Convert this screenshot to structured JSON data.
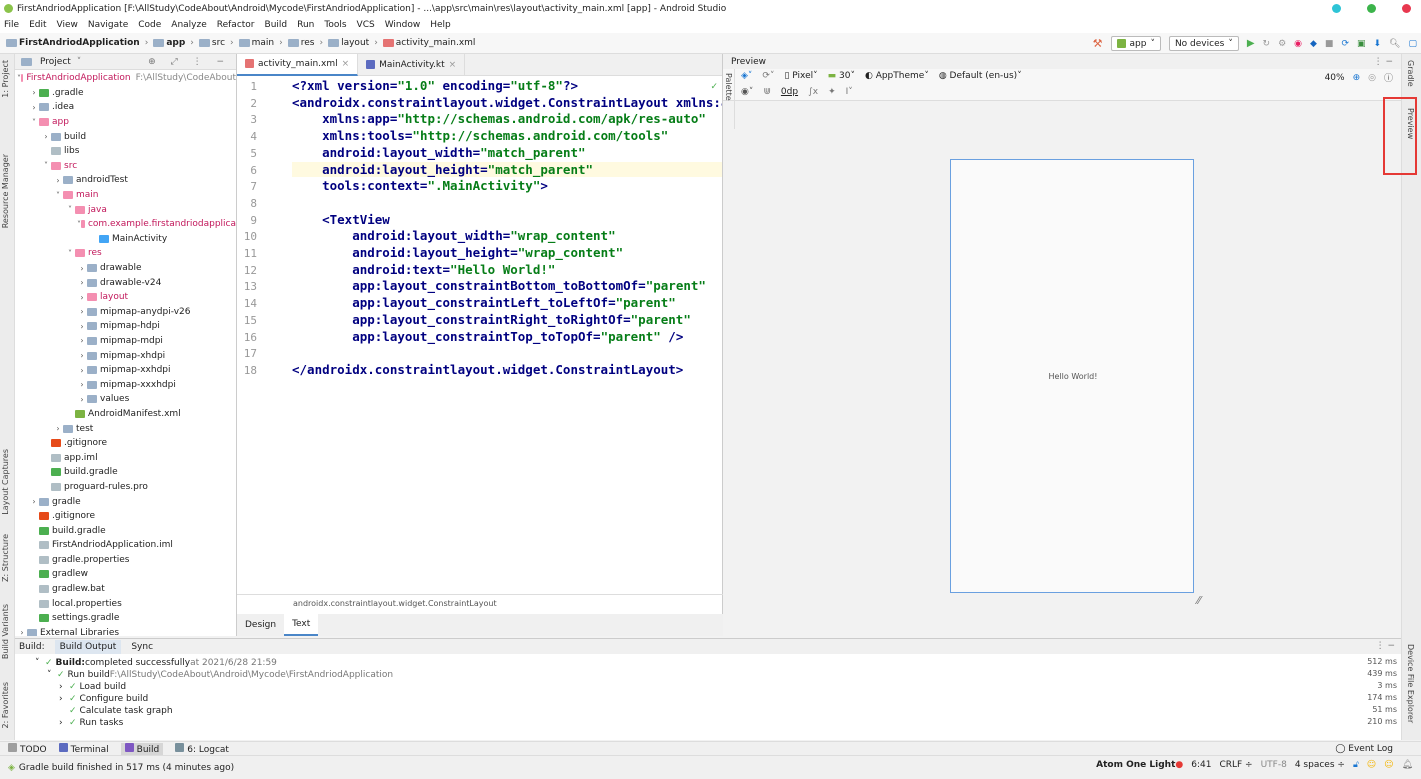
{
  "window": {
    "title": "FirstAndriodApplication [F:\\AllStudy\\CodeAbout\\Android\\Mycode\\FirstAndriodApplication] - ...\\app\\src\\main\\res\\layout\\activity_main.xml [app] - Android Studio"
  },
  "menu": [
    "File",
    "Edit",
    "View",
    "Navigate",
    "Code",
    "Analyze",
    "Refactor",
    "Build",
    "Run",
    "Tools",
    "VCS",
    "Window",
    "Help"
  ],
  "breadcrumb": [
    "FirstAndriodApplication",
    "app",
    "src",
    "main",
    "res",
    "layout",
    "activity_main.xml"
  ],
  "toolbar": {
    "module": "app",
    "devices": "No devices"
  },
  "project_panel": {
    "title": "Project",
    "tree": [
      {
        "label": "FirstAndriodApplication",
        "extra": "F:\\AllStudy\\CodeAbout",
        "indent": 0,
        "arrow": "˅",
        "red": true
      },
      {
        "label": ".gradle",
        "indent": 1,
        "arrow": "›"
      },
      {
        "label": ".idea",
        "indent": 1,
        "arrow": "›"
      },
      {
        "label": "app",
        "indent": 1,
        "arrow": "˅",
        "red": true
      },
      {
        "label": "build",
        "indent": 2,
        "arrow": "›"
      },
      {
        "label": "libs",
        "indent": 2,
        "arrow": ""
      },
      {
        "label": "src",
        "indent": 2,
        "arrow": "˅",
        "red": true
      },
      {
        "label": "androidTest",
        "indent": 3,
        "arrow": "›"
      },
      {
        "label": "main",
        "indent": 3,
        "arrow": "˅",
        "red": true
      },
      {
        "label": "java",
        "indent": 4,
        "arrow": "˅",
        "red": true
      },
      {
        "label": "com.example.firstandriodapplica",
        "indent": 5,
        "arrow": "˅",
        "red": true
      },
      {
        "label": "MainActivity",
        "indent": 6,
        "arrow": ""
      },
      {
        "label": "res",
        "indent": 4,
        "arrow": "˅",
        "red": true
      },
      {
        "label": "drawable",
        "indent": 5,
        "arrow": "›"
      },
      {
        "label": "drawable-v24",
        "indent": 5,
        "arrow": "›"
      },
      {
        "label": "layout",
        "indent": 5,
        "arrow": "›",
        "red": true
      },
      {
        "label": "mipmap-anydpi-v26",
        "indent": 5,
        "arrow": "›"
      },
      {
        "label": "mipmap-hdpi",
        "indent": 5,
        "arrow": "›"
      },
      {
        "label": "mipmap-mdpi",
        "indent": 5,
        "arrow": "›"
      },
      {
        "label": "mipmap-xhdpi",
        "indent": 5,
        "arrow": "›"
      },
      {
        "label": "mipmap-xxhdpi",
        "indent": 5,
        "arrow": "›"
      },
      {
        "label": "mipmap-xxxhdpi",
        "indent": 5,
        "arrow": "›"
      },
      {
        "label": "values",
        "indent": 5,
        "arrow": "›"
      },
      {
        "label": "AndroidManifest.xml",
        "indent": 4,
        "arrow": ""
      },
      {
        "label": "test",
        "indent": 3,
        "arrow": "›"
      },
      {
        "label": ".gitignore",
        "indent": 2,
        "arrow": ""
      },
      {
        "label": "app.iml",
        "indent": 2,
        "arrow": ""
      },
      {
        "label": "build.gradle",
        "indent": 2,
        "arrow": ""
      },
      {
        "label": "proguard-rules.pro",
        "indent": 2,
        "arrow": ""
      },
      {
        "label": "gradle",
        "indent": 1,
        "arrow": "›"
      },
      {
        "label": ".gitignore",
        "indent": 1,
        "arrow": ""
      },
      {
        "label": "build.gradle",
        "indent": 1,
        "arrow": ""
      },
      {
        "label": "FirstAndriodApplication.iml",
        "indent": 1,
        "arrow": ""
      },
      {
        "label": "gradle.properties",
        "indent": 1,
        "arrow": ""
      },
      {
        "label": "gradlew",
        "indent": 1,
        "arrow": ""
      },
      {
        "label": "gradlew.bat",
        "indent": 1,
        "arrow": ""
      },
      {
        "label": "local.properties",
        "indent": 1,
        "arrow": ""
      },
      {
        "label": "settings.gradle",
        "indent": 1,
        "arrow": ""
      },
      {
        "label": "External Libraries",
        "indent": 0,
        "arrow": "›"
      }
    ]
  },
  "editor": {
    "tabs": [
      {
        "label": "activity_main.xml",
        "active": true
      },
      {
        "label": "MainActivity.kt",
        "active": false
      }
    ],
    "lines": [
      "<?xml version=\"1.0\" encoding=\"utf-8\"?>",
      "<androidx.constraintlayout.widget.ConstraintLayout xmlns:and",
      "    xmlns:app=\"http://schemas.android.com/apk/res-auto\"",
      "    xmlns:tools=\"http://schemas.android.com/tools\"",
      "    android:layout_width=\"match_parent\"",
      "    android:layout_height=\"match_parent\"",
      "    tools:context=\".MainActivity\">",
      "",
      "    <TextView",
      "        android:layout_width=\"wrap_content\"",
      "        android:layout_height=\"wrap_content\"",
      "        android:text=\"Hello World!\"",
      "        app:layout_constraintBottom_toBottomOf=\"parent\"",
      "        app:layout_constraintLeft_toLeftOf=\"parent\"",
      "        app:layout_constraintRight_toRightOf=\"parent\"",
      "        app:layout_constraintTop_toTopOf=\"parent\" />",
      "",
      "</androidx.constraintlayout.widget.ConstraintLayout>"
    ],
    "highlight_line": 6,
    "breadcrumb": "androidx.constraintlayout.widget.ConstraintLayout",
    "mode_tabs": [
      "Design",
      "Text"
    ],
    "active_mode": "Text"
  },
  "preview": {
    "title": "Preview",
    "device": "Pixel",
    "api": "30",
    "theme": "AppTheme",
    "locale": "Default (en-us)",
    "zoom": "40%",
    "margin": "0dp",
    "phone_text": "Hello World!"
  },
  "build": {
    "tabs": [
      "Build:",
      "Build Output",
      "Sync"
    ],
    "lines": [
      {
        "prefix": "Build:",
        "text": " completed successfully",
        "suffix": " at 2021/6/28 21:59",
        "time": "512 ms",
        "indent": 0,
        "arrow": "˅"
      },
      {
        "prefix": "",
        "text": "Run build",
        "suffix": " F:\\AllStudy\\CodeAbout\\Android\\Mycode\\FirstAndriodApplication",
        "time": "439 ms",
        "indent": 1,
        "arrow": "˅"
      },
      {
        "prefix": "",
        "text": "Load build",
        "suffix": "",
        "time": "3 ms",
        "indent": 2,
        "arrow": "›"
      },
      {
        "prefix": "",
        "text": "Configure build",
        "suffix": "",
        "time": "174 ms",
        "indent": 2,
        "arrow": "›"
      },
      {
        "prefix": "",
        "text": "Calculate task graph",
        "suffix": "",
        "time": "51 ms",
        "indent": 2,
        "arrow": ""
      },
      {
        "prefix": "",
        "text": "Run tasks",
        "suffix": "",
        "time": "210 ms",
        "indent": 2,
        "arrow": "›"
      }
    ]
  },
  "bottom_tabs": [
    "TODO",
    "Terminal",
    "Build",
    "6: Logcat"
  ],
  "event_log": "Event Log",
  "status": {
    "message": "Gradle build finished in 517 ms (4 minutes ago)",
    "theme": "Atom One Light",
    "position": "6:41",
    "line_sep": "CRLF",
    "encoding": "UTF-8",
    "indent": "4 spaces"
  },
  "side_labels": {
    "left": [
      "1: Project",
      "Resource Manager",
      "Layout Captures",
      "Z: Structure",
      "Build Variants",
      "2: Favorites"
    ],
    "right": [
      "Gradle",
      "Preview",
      "Device File Explorer"
    ]
  },
  "colors": {
    "accent": "#4a86c8",
    "redbox": "#e53935",
    "string": "#067d17",
    "keyword": "#000080"
  }
}
